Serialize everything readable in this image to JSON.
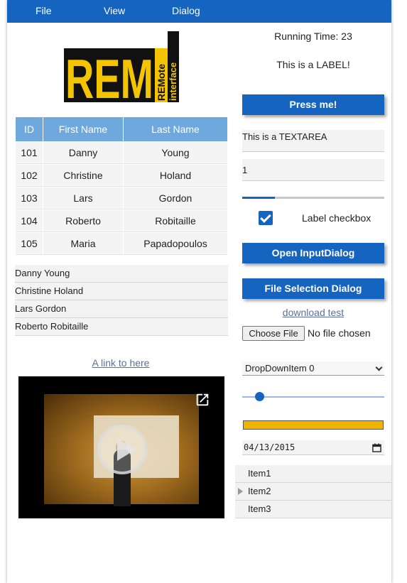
{
  "menu": {
    "file": "File",
    "view": "View",
    "dialog": "Dialog"
  },
  "logo": {
    "big_text": "REM",
    "small_text_1": "REMote",
    "small_text_2": "interface"
  },
  "table": {
    "headers": [
      "ID",
      "First Name",
      "Last Name"
    ],
    "rows": [
      [
        "101",
        "Danny",
        "Young"
      ],
      [
        "102",
        "Christine",
        "Holand"
      ],
      [
        "103",
        "Lars",
        "Gordon"
      ],
      [
        "104",
        "Roberto",
        "Robitaille"
      ],
      [
        "105",
        "Maria",
        "Papadopoulos"
      ]
    ]
  },
  "list": {
    "items": [
      "Danny Young",
      "Christine Holand",
      "Lars Gordon",
      "Roberto Robitaille"
    ]
  },
  "link_text": "A link to here",
  "running_time": "Running Time: 23",
  "label": "This is a LABEL!",
  "press_button": "Press me!",
  "textarea_value": "This is a TEXTAREA",
  "number_value": "1",
  "thin_progress_fraction": 0.23,
  "checkbox": {
    "checked": true,
    "label": "Label checkbox"
  },
  "input_dialog_button": "Open InputDialog",
  "file_dialog_button": "File Selection Dialog",
  "download_link": "download test",
  "file_input": {
    "button": "Choose File",
    "status": "No file chosen"
  },
  "dropdown_value": "DropDownItem 0",
  "slider_fraction": 0.12,
  "progress_fraction": 1.0,
  "date_value": "04/13/2015",
  "tree": {
    "items": [
      "Item1",
      "Item2",
      "Item3"
    ]
  },
  "colors": {
    "primary": "#1565c0",
    "header_blue": "#6fa8dc",
    "progress_yellow": "#f0b400",
    "logo_yellow": "#f5c400"
  },
  "icons": {
    "video_external": "open-in-new-icon",
    "video_play": "play-icon",
    "date": "calendar-icon",
    "tree_expand": "triangle-right-icon"
  }
}
